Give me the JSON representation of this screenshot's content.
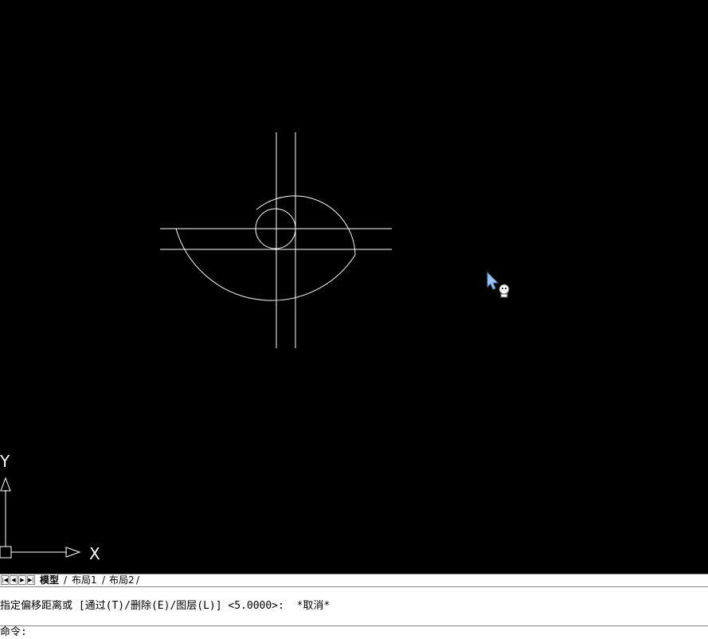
{
  "ucs": {
    "y_label": "Y",
    "x_label": "X"
  },
  "tabs": {
    "items": [
      {
        "label": "模型",
        "active": true
      },
      {
        "label": "布局1",
        "active": false
      },
      {
        "label": "布局2",
        "active": false
      }
    ]
  },
  "command": {
    "history_line_1": "",
    "history_line_2": "指定偏移距离或 [通过(T)/删除(E)/图层(L)] <5.0000>:  *取消*",
    "prompt": "命令:"
  },
  "colors": {
    "background": "#000000",
    "geometry": "#ffffff",
    "panel": "#ffffff"
  }
}
